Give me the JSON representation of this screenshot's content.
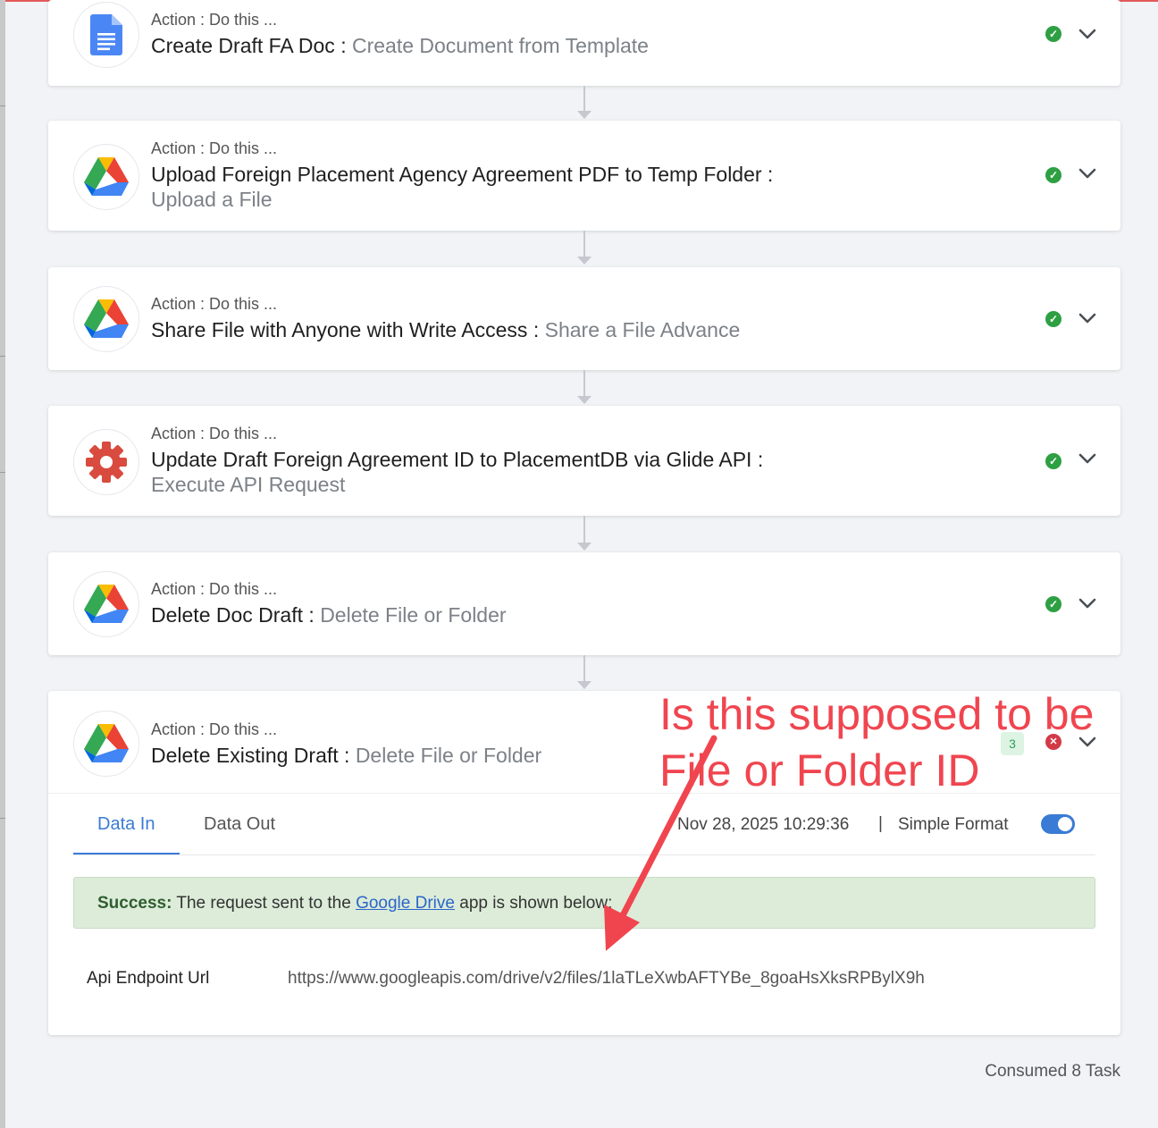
{
  "steps": [
    {
      "action_label": "Action : Do this ...",
      "name": "Create Draft FA Doc",
      "separator": " : ",
      "event": "Create Document from Template",
      "app_icon": "google-docs-icon",
      "status": "success"
    },
    {
      "action_label": "Action : Do this ...",
      "name": "Upload Foreign Placement Agency Agreement PDF to Temp Folder",
      "separator": " : ",
      "event": "Upload a File",
      "app_icon": "google-drive-icon",
      "status": "success"
    },
    {
      "action_label": "Action : Do this ...",
      "name": "Share File with Anyone with Write Access",
      "separator": " : ",
      "event": "Share a File Advance",
      "app_icon": "google-drive-icon",
      "status": "success"
    },
    {
      "action_label": "Action : Do this ...",
      "name": "Update Draft Foreign Agreement ID to PlacementDB via Glide API",
      "separator": " : ",
      "event": "Execute API Request",
      "app_icon": "api-gear-icon",
      "status": "success"
    },
    {
      "action_label": "Action : Do this ...",
      "name": "Delete Doc Draft",
      "separator": " : ",
      "event": "Delete File or Folder",
      "app_icon": "google-drive-icon",
      "status": "success"
    },
    {
      "action_label": "Action : Do this ...",
      "name": "Delete Existing Draft",
      "separator": " : ",
      "event": "Delete File or Folder",
      "app_icon": "google-drive-icon",
      "status": "error",
      "badge_count": "3"
    }
  ],
  "expanded": {
    "tabs": [
      "Data In",
      "Data Out"
    ],
    "active_tab": "Data In",
    "timestamp": "Nov 28, 2025 10:29:36",
    "pipe": "|",
    "simple_format_label": "Simple Format",
    "simple_format_on": true,
    "success": {
      "prefix": "Success:",
      "text_before": " The request sent to the ",
      "link": "Google Drive",
      "text_after": " app is shown below:"
    },
    "fields": [
      {
        "key": "Api Endpoint Url",
        "value": "https://www.googleapis.com/drive/v2/files/1laTLeXwbAFTYBe_8goaHsXksRPBylX9h"
      }
    ]
  },
  "consumed": "Consumed 8 Task",
  "annotation": {
    "line1": "Is this supposed to be",
    "line2": "File or Folder ID",
    "color": "#f0454f"
  },
  "colors": {
    "accent": "#3a7bd5",
    "success": "#2ea043",
    "error": "#d33a47"
  }
}
